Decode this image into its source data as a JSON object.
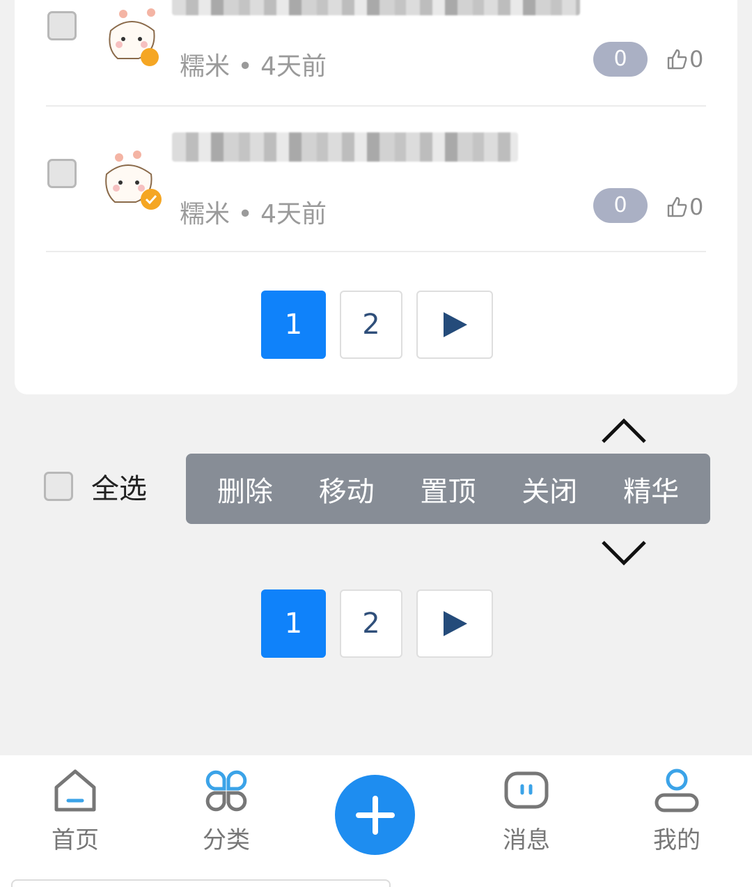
{
  "posts": [
    {
      "author": "糯米",
      "time": "4天前",
      "replies": "0",
      "likes": "0"
    },
    {
      "author": "糯米",
      "time": "4天前",
      "replies": "0",
      "likes": "0"
    }
  ],
  "meta_separator": "•",
  "pagination_top": {
    "pages": [
      "1",
      "2"
    ],
    "active": "1"
  },
  "pagination_bottom": {
    "pages": [
      "1",
      "2"
    ],
    "active": "1"
  },
  "batch": {
    "select_all": "全选",
    "actions": [
      "删除",
      "移动",
      "置顶",
      "关闭",
      "精华"
    ]
  },
  "tabbar": {
    "home": "首页",
    "category": "分类",
    "messages": "消息",
    "mine": "我的"
  },
  "colors": {
    "accent": "#0f82fa",
    "fab": "#1e8df0",
    "action_bar": "#878d96",
    "tab_icon_active": "#3ba3e8"
  }
}
